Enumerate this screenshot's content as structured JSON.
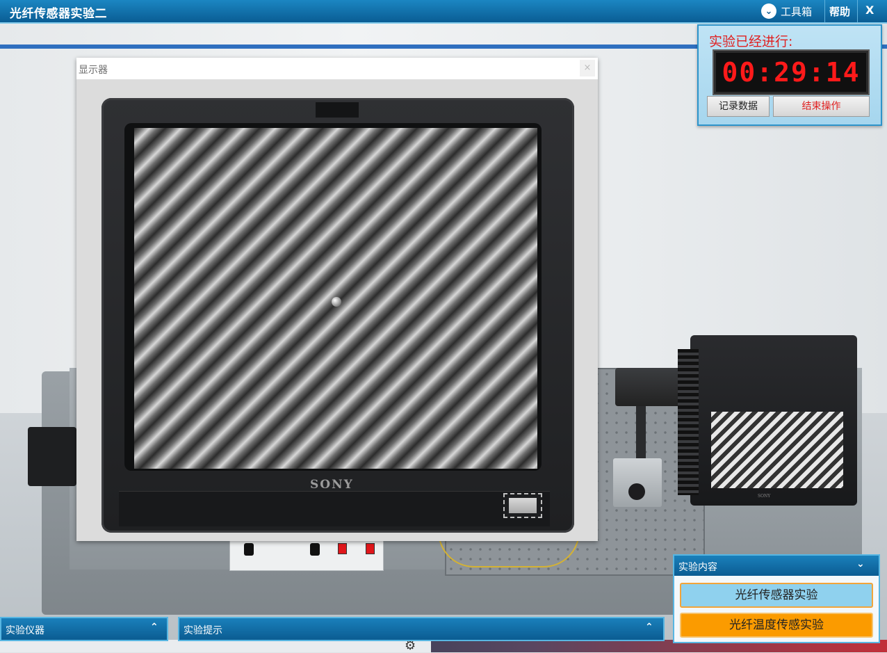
{
  "window": {
    "title": "光纤传感器实验二",
    "toolbox_label": "工具箱",
    "help_label": "帮助",
    "close_label": "X"
  },
  "display_dialog": {
    "title": "显示器",
    "close_label": "×",
    "brand": "SONY"
  },
  "small_monitor": {
    "brand": "SONY"
  },
  "timer": {
    "title": "实验已经进行:",
    "value": "00:29:14",
    "record_label": "记录数据",
    "end_label": "结束操作"
  },
  "panels": {
    "instruments": "实验仪器",
    "tips": "实验提示",
    "content": "实验内容"
  },
  "experiments": [
    {
      "label": "光纤传感器实验",
      "active": true
    },
    {
      "label": "光纤温度传感实验",
      "active": false
    }
  ],
  "colors": {
    "title_bar": "#0a5d94",
    "timer_digits": "#ff1a1a",
    "end_button_text": "#e02020",
    "experiment_active": "#8fd1ee",
    "experiment_other": "#fb9b00"
  }
}
